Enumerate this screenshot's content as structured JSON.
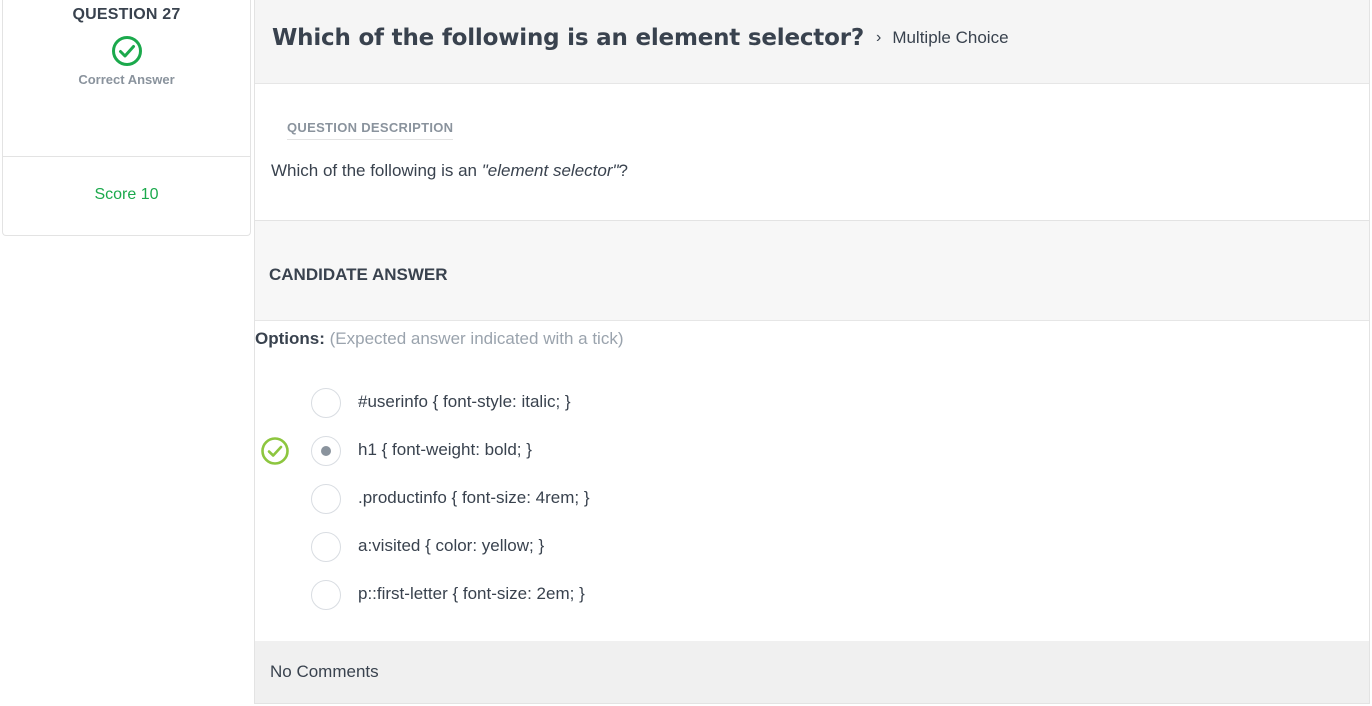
{
  "score_panel": {
    "question_number": "QUESTION 27",
    "status_icon": "check-circle-icon",
    "status_text": "Correct Answer",
    "score_text": "Score 10",
    "success_color": "#1ba94c"
  },
  "question": {
    "title": "Which of the following is an element selector?",
    "breadcrumb_separator": "›",
    "type": "Multiple Choice",
    "description_label": "QUESTION DESCRIPTION",
    "description_prefix": "Which of the following is an ",
    "description_emphasis": "\"element selector\"",
    "description_suffix": "?"
  },
  "candidate": {
    "header": "CANDIDATE ANSWER",
    "options_label": "Options:",
    "options_hint": "(Expected answer indicated with a tick)",
    "options": [
      {
        "label": "#userinfo { font-style: italic; }",
        "selected": false,
        "expected": false
      },
      {
        "label": "h1 { font-weight: bold; }",
        "selected": true,
        "expected": true
      },
      {
        "label": ".productinfo { font-size: 4rem; }",
        "selected": false,
        "expected": false
      },
      {
        "label": "a:visited { color: yellow; }",
        "selected": false,
        "expected": false
      },
      {
        "label": "p::first-letter { font-size: 2em; }",
        "selected": false,
        "expected": false
      }
    ]
  },
  "comments": {
    "text": "No Comments"
  }
}
